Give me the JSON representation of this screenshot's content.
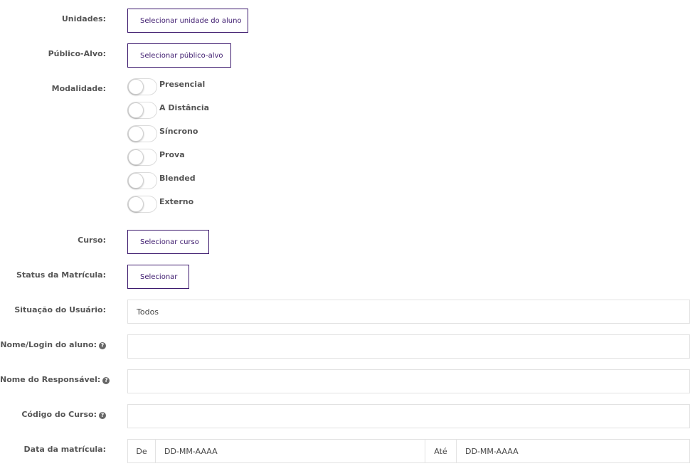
{
  "filters": {
    "unidades": {
      "label": "Unidades:",
      "button": "Selecionar unidade do aluno"
    },
    "publico_alvo": {
      "label": "Público-Alvo:",
      "button": "Selecionar público-alvo"
    },
    "modalidade": {
      "label": "Modalidade:",
      "options": [
        {
          "label": "Presencial",
          "on": false
        },
        {
          "label": "A Distância",
          "on": false
        },
        {
          "label": "Síncrono",
          "on": false
        },
        {
          "label": "Prova",
          "on": false
        },
        {
          "label": "Blended",
          "on": false
        },
        {
          "label": "Externo",
          "on": false
        }
      ]
    },
    "curso": {
      "label": "Curso:",
      "button": "Selecionar curso"
    },
    "status_matricula": {
      "label": "Status da Matrícula:",
      "button": "Selecionar"
    },
    "situacao_usuario": {
      "label": "Situação do Usuário:",
      "value": "Todos"
    },
    "nome_login": {
      "label": "Nome/Login do aluno:",
      "help": "?",
      "value": ""
    },
    "nome_responsavel": {
      "label": "Nome do Responsável:",
      "help": "?",
      "value": ""
    },
    "codigo_curso": {
      "label": "Código do Curso:",
      "help": "?",
      "value": ""
    },
    "data_matricula": {
      "label": "Data da matrícula:",
      "from_label": "De",
      "from_placeholder": "DD-MM-AAAA",
      "to_label": "Até",
      "to_placeholder": "DD-MM-AAAA"
    }
  },
  "colors": {
    "accent": "#3d1a6e",
    "label": "#555555",
    "border": "#e2e2e2"
  }
}
